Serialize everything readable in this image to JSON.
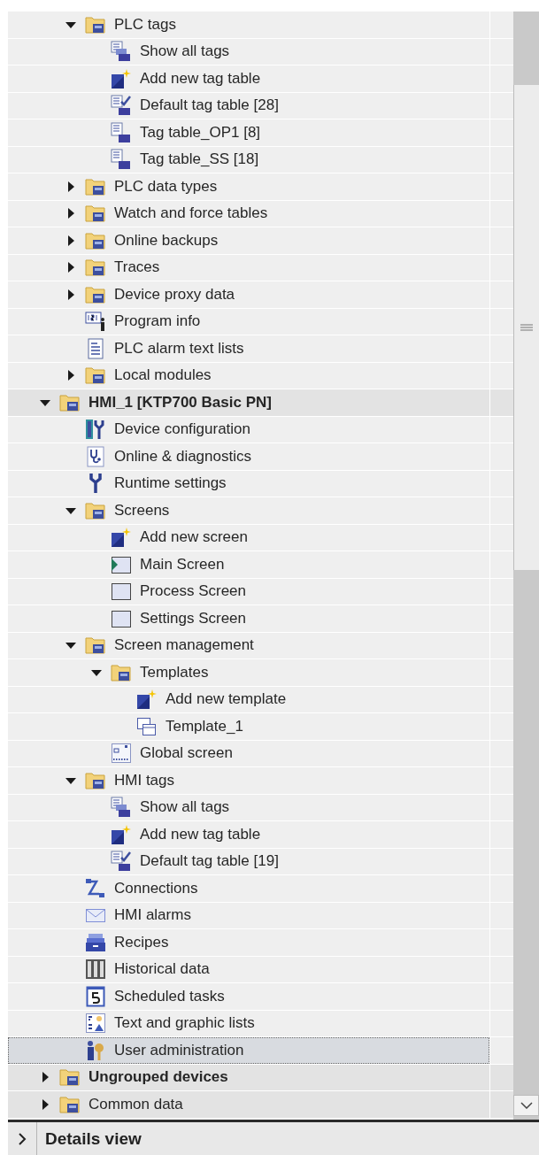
{
  "tree": [
    {
      "children": [
        {
          "label": "PLC tags",
          "kind": "folder",
          "expanded": true,
          "selected": false,
          "children": [
            {
              "label": "Show all tags",
              "kind": "tags",
              "selected": false
            },
            {
              "label": "Add new tag table",
              "kind": "add",
              "selected": false
            },
            {
              "label": "Default tag table [28]",
              "kind": "checktable",
              "selected": false
            },
            {
              "label": "Tag table_OP1 [8]",
              "kind": "table",
              "selected": false
            },
            {
              "label": "Tag table_SS [18]",
              "kind": "table",
              "selected": false
            }
          ]
        },
        {
          "label": "PLC data types",
          "kind": "folder",
          "expanded": false,
          "selected": false
        },
        {
          "label": "Watch and force tables",
          "kind": "folder",
          "expanded": false,
          "selected": false
        },
        {
          "label": "Online backups",
          "kind": "folder",
          "expanded": false,
          "selected": false
        },
        {
          "label": "Traces",
          "kind": "folder",
          "expanded": false,
          "selected": false
        },
        {
          "label": "Device proxy data",
          "kind": "folder",
          "expanded": false,
          "selected": false
        },
        {
          "label": "Program info",
          "kind": "info",
          "selected": false
        },
        {
          "label": "PLC alarm text lists",
          "kind": "list",
          "selected": false
        },
        {
          "label": "Local modules",
          "kind": "folder",
          "expanded": false,
          "selected": false
        }
      ]
    },
    {
      "label": "HMI_1 [KTP700 Basic PN]",
      "kind": "folder",
      "bold": true,
      "expanded": true,
      "selected": false,
      "children": [
        {
          "label": "Device configuration",
          "kind": "config",
          "selected": false
        },
        {
          "label": "Online & diagnostics",
          "kind": "probe",
          "selected": false
        },
        {
          "label": "Runtime settings",
          "kind": "wrench",
          "selected": false
        },
        {
          "label": "Screens",
          "kind": "folder",
          "expanded": true,
          "selected": false,
          "children": [
            {
              "label": "Add new screen",
              "kind": "add",
              "selected": false
            },
            {
              "label": "Main Screen",
              "kind": "playscreen",
              "selected": false
            },
            {
              "label": "Process Screen",
              "kind": "screen",
              "selected": false
            },
            {
              "label": "Settings Screen",
              "kind": "screen",
              "selected": false
            }
          ]
        },
        {
          "label": "Screen management",
          "kind": "folder",
          "expanded": true,
          "selected": false,
          "children": [
            {
              "label": "Templates",
              "kind": "folder",
              "expanded": true,
              "selected": false,
              "children": [
                {
                  "label": "Add new template",
                  "kind": "add",
                  "selected": false
                },
                {
                  "label": "Template_1",
                  "kind": "template",
                  "selected": false
                }
              ]
            },
            {
              "label": "Global screen",
              "kind": "globalscreen",
              "selected": false
            }
          ]
        },
        {
          "label": "HMI tags",
          "kind": "folder",
          "expanded": true,
          "selected": false,
          "children": [
            {
              "label": "Show all tags",
              "kind": "tags",
              "selected": false
            },
            {
              "label": "Add new tag table",
              "kind": "add",
              "selected": false
            },
            {
              "label": "Default tag table [19]",
              "kind": "checktable",
              "selected": false
            }
          ]
        },
        {
          "label": "Connections",
          "kind": "connection",
          "selected": false
        },
        {
          "label": "HMI alarms",
          "kind": "envelope",
          "selected": false
        },
        {
          "label": "Recipes",
          "kind": "drawer",
          "selected": false
        },
        {
          "label": "Historical data",
          "kind": "binders",
          "selected": false
        },
        {
          "label": "Scheduled tasks",
          "kind": "calendar",
          "selected": false
        },
        {
          "label": "Text and graphic lists",
          "kind": "graphiclist",
          "selected": false
        },
        {
          "label": "User administration",
          "kind": "user",
          "selected": true
        }
      ]
    },
    {
      "label": "Ungrouped devices",
      "kind": "folder",
      "bold": true,
      "expanded": false,
      "selected": false
    },
    {
      "label": "Common data",
      "kind": "folder",
      "bold": false,
      "expanded": false,
      "selected": false
    }
  ],
  "details_view": {
    "label": "Details view",
    "expanded": false
  }
}
